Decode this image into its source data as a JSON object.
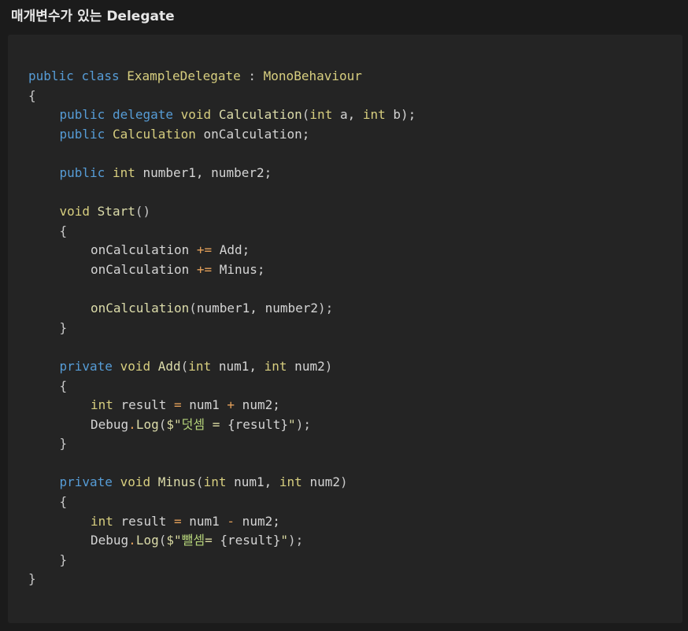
{
  "heading": "매개변수가 있는 Delegate",
  "code_lines": [
    {
      "indent": 0,
      "tokens": [
        {
          "t": "public",
          "c": "kw"
        },
        {
          "t": " ",
          "c": "pl"
        },
        {
          "t": "class",
          "c": "kw"
        },
        {
          "t": " ",
          "c": "pl"
        },
        {
          "t": "ExampleDelegate",
          "c": "ty"
        },
        {
          "t": " : ",
          "c": "pu"
        },
        {
          "t": "MonoBehaviour",
          "c": "ty"
        }
      ]
    },
    {
      "indent": 0,
      "tokens": [
        {
          "t": "{",
          "c": "pu"
        }
      ]
    },
    {
      "indent": 1,
      "tokens": [
        {
          "t": "public",
          "c": "kw"
        },
        {
          "t": " ",
          "c": "pl"
        },
        {
          "t": "delegate",
          "c": "kw"
        },
        {
          "t": " ",
          "c": "pl"
        },
        {
          "t": "void",
          "c": "ty"
        },
        {
          "t": " ",
          "c": "pl"
        },
        {
          "t": "Calculation",
          "c": "fn"
        },
        {
          "t": "(",
          "c": "pu"
        },
        {
          "t": "int",
          "c": "ty"
        },
        {
          "t": " a, ",
          "c": "pl"
        },
        {
          "t": "int",
          "c": "ty"
        },
        {
          "t": " b);",
          "c": "pl"
        }
      ]
    },
    {
      "indent": 1,
      "tokens": [
        {
          "t": "public",
          "c": "kw"
        },
        {
          "t": " ",
          "c": "pl"
        },
        {
          "t": "Calculation",
          "c": "ty"
        },
        {
          "t": " onCalculation;",
          "c": "pl"
        }
      ]
    },
    {
      "indent": 0,
      "tokens": []
    },
    {
      "indent": 1,
      "tokens": [
        {
          "t": "public",
          "c": "kw"
        },
        {
          "t": " ",
          "c": "pl"
        },
        {
          "t": "int",
          "c": "ty"
        },
        {
          "t": " number1, number2;",
          "c": "pl"
        }
      ]
    },
    {
      "indent": 0,
      "tokens": []
    },
    {
      "indent": 1,
      "tokens": [
        {
          "t": "void",
          "c": "ty"
        },
        {
          "t": " ",
          "c": "pl"
        },
        {
          "t": "Start",
          "c": "fn"
        },
        {
          "t": "()",
          "c": "pu"
        }
      ]
    },
    {
      "indent": 1,
      "tokens": [
        {
          "t": "{",
          "c": "pu"
        }
      ]
    },
    {
      "indent": 2,
      "tokens": [
        {
          "t": "onCalculation ",
          "c": "pl"
        },
        {
          "t": "+=",
          "c": "op"
        },
        {
          "t": " Add;",
          "c": "pl"
        }
      ]
    },
    {
      "indent": 2,
      "tokens": [
        {
          "t": "onCalculation ",
          "c": "pl"
        },
        {
          "t": "+=",
          "c": "op"
        },
        {
          "t": " Minus;",
          "c": "pl"
        }
      ]
    },
    {
      "indent": 0,
      "tokens": []
    },
    {
      "indent": 2,
      "tokens": [
        {
          "t": "onCalculation",
          "c": "fn"
        },
        {
          "t": "(",
          "c": "pu"
        },
        {
          "t": "number1, number2",
          "c": "pl"
        },
        {
          "t": ");",
          "c": "pu"
        }
      ]
    },
    {
      "indent": 1,
      "tokens": [
        {
          "t": "}",
          "c": "pu"
        }
      ]
    },
    {
      "indent": 0,
      "tokens": []
    },
    {
      "indent": 1,
      "tokens": [
        {
          "t": "private",
          "c": "kw"
        },
        {
          "t": " ",
          "c": "pl"
        },
        {
          "t": "void",
          "c": "ty"
        },
        {
          "t": " ",
          "c": "pl"
        },
        {
          "t": "Add",
          "c": "fn"
        },
        {
          "t": "(",
          "c": "pu"
        },
        {
          "t": "int",
          "c": "ty"
        },
        {
          "t": " num1, ",
          "c": "pl"
        },
        {
          "t": "int",
          "c": "ty"
        },
        {
          "t": " num2",
          "c": "pl"
        },
        {
          "t": ")",
          "c": "pu"
        }
      ]
    },
    {
      "indent": 1,
      "tokens": [
        {
          "t": "{",
          "c": "pu"
        }
      ]
    },
    {
      "indent": 2,
      "tokens": [
        {
          "t": "int",
          "c": "ty"
        },
        {
          "t": " result ",
          "c": "pl"
        },
        {
          "t": "=",
          "c": "op"
        },
        {
          "t": " num1 ",
          "c": "pl"
        },
        {
          "t": "+",
          "c": "op"
        },
        {
          "t": " num2;",
          "c": "pl"
        }
      ]
    },
    {
      "indent": 2,
      "tokens": [
        {
          "t": "Debug",
          "c": "pl"
        },
        {
          "t": ".",
          "c": "op"
        },
        {
          "t": "Log",
          "c": "fn"
        },
        {
          "t": "(",
          "c": "pu"
        },
        {
          "t": "$\"",
          "c": "st"
        },
        {
          "t": "덧셈",
          "c": "ko"
        },
        {
          "t": " = ",
          "c": "st"
        },
        {
          "t": "{result}",
          "c": "pl"
        },
        {
          "t": "\"",
          "c": "st"
        },
        {
          "t": ");",
          "c": "pu"
        }
      ]
    },
    {
      "indent": 1,
      "tokens": [
        {
          "t": "}",
          "c": "pu"
        }
      ]
    },
    {
      "indent": 0,
      "tokens": []
    },
    {
      "indent": 1,
      "tokens": [
        {
          "t": "private",
          "c": "kw"
        },
        {
          "t": " ",
          "c": "pl"
        },
        {
          "t": "void",
          "c": "ty"
        },
        {
          "t": " ",
          "c": "pl"
        },
        {
          "t": "Minus",
          "c": "fn"
        },
        {
          "t": "(",
          "c": "pu"
        },
        {
          "t": "int",
          "c": "ty"
        },
        {
          "t": " num1, ",
          "c": "pl"
        },
        {
          "t": "int",
          "c": "ty"
        },
        {
          "t": " num2",
          "c": "pl"
        },
        {
          "t": ")",
          "c": "pu"
        }
      ]
    },
    {
      "indent": 1,
      "tokens": [
        {
          "t": "{",
          "c": "pu"
        }
      ]
    },
    {
      "indent": 2,
      "tokens": [
        {
          "t": "int",
          "c": "ty"
        },
        {
          "t": " result ",
          "c": "pl"
        },
        {
          "t": "=",
          "c": "op"
        },
        {
          "t": " num1 ",
          "c": "pl"
        },
        {
          "t": "-",
          "c": "op"
        },
        {
          "t": " num2;",
          "c": "pl"
        }
      ]
    },
    {
      "indent": 2,
      "tokens": [
        {
          "t": "Debug",
          "c": "pl"
        },
        {
          "t": ".",
          "c": "op"
        },
        {
          "t": "Log",
          "c": "fn"
        },
        {
          "t": "(",
          "c": "pu"
        },
        {
          "t": "$\"",
          "c": "st"
        },
        {
          "t": "뺄셈",
          "c": "ko"
        },
        {
          "t": "= ",
          "c": "st"
        },
        {
          "t": "{result}",
          "c": "pl"
        },
        {
          "t": "\"",
          "c": "st"
        },
        {
          "t": ");",
          "c": "pu"
        }
      ]
    },
    {
      "indent": 1,
      "tokens": [
        {
          "t": "}",
          "c": "pu"
        }
      ]
    },
    {
      "indent": 0,
      "tokens": [
        {
          "t": "}",
          "c": "pu"
        }
      ]
    }
  ]
}
